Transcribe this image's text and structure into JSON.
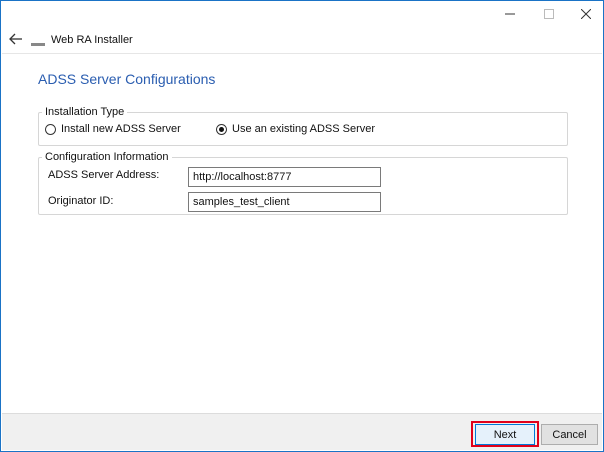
{
  "window": {
    "title": "Web RA  Installer",
    "controls": {
      "minimize_icon": "minimize-icon",
      "maximize_icon": "maximize-icon",
      "close_icon": "close-icon"
    }
  },
  "page": {
    "title": "ADSS Server Configurations"
  },
  "installation_type": {
    "legend": "Installation Type",
    "options": [
      {
        "label": "Install new ADSS Server",
        "checked": false
      },
      {
        "label": "Use an existing ADSS Server",
        "checked": true
      }
    ]
  },
  "configuration": {
    "legend": "Configuration Information",
    "server_address_label": "ADSS Server Address:",
    "server_address_value": "http://localhost:8777",
    "originator_label": "Originator ID:",
    "originator_value": "samples_test_client"
  },
  "footer": {
    "next_label": "Next",
    "cancel_label": "Cancel"
  },
  "colors": {
    "title_blue": "#2a5db0",
    "highlight_red": "#e0001b",
    "window_border": "#1a73c6"
  }
}
